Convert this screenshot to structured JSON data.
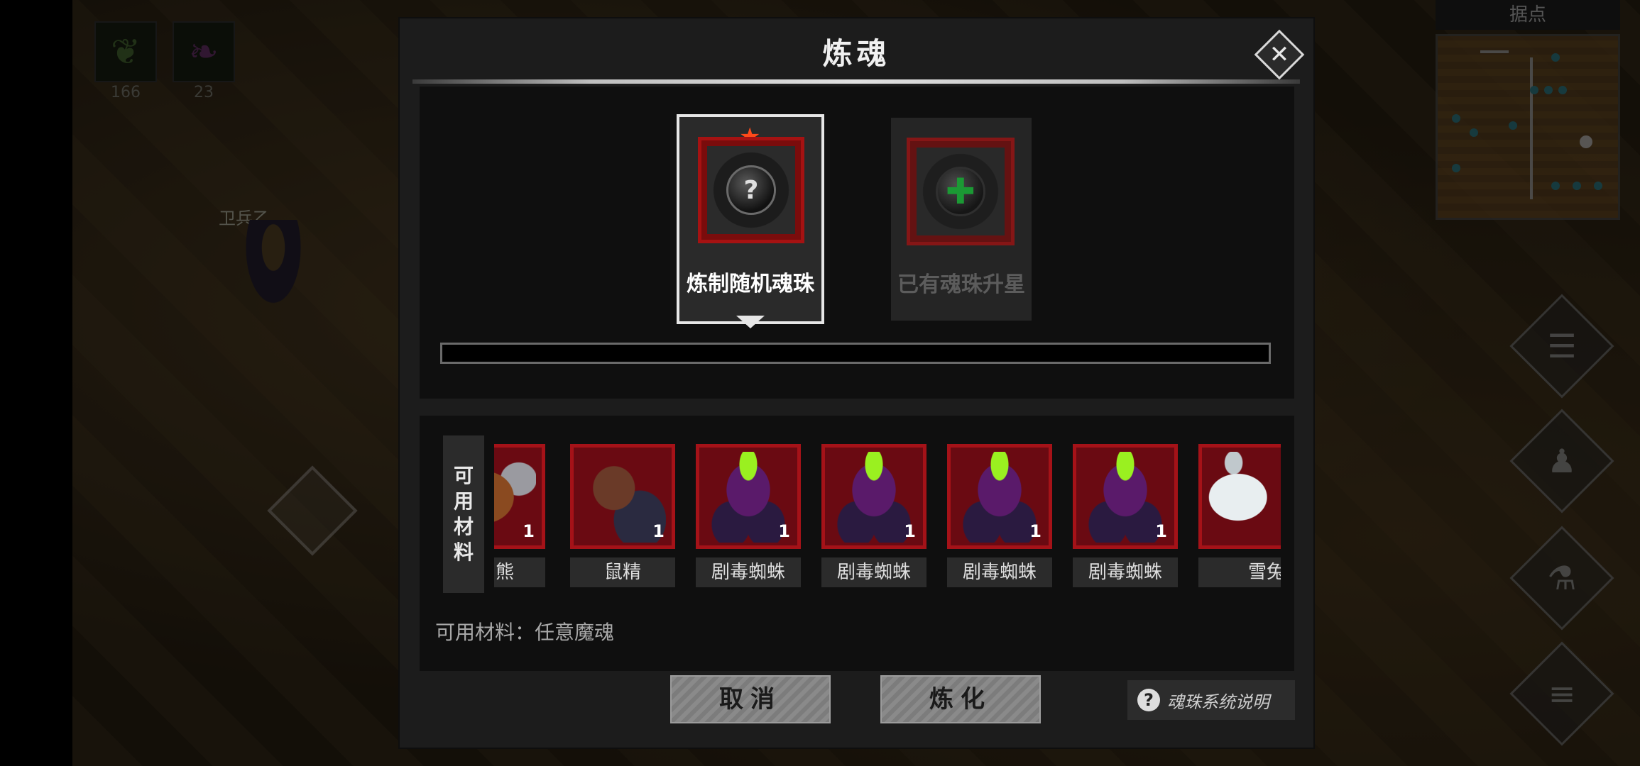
{
  "hud": {
    "slots": [
      {
        "icon": "green-leaf-icon",
        "count": "166"
      },
      {
        "icon": "purple-feather-icon",
        "count": "23"
      }
    ],
    "npc_name": "卫兵乙",
    "minimap_title": "据点"
  },
  "side_buttons": [
    {
      "icon": "scroll-icon"
    },
    {
      "icon": "party-icon"
    },
    {
      "icon": "potion-icon"
    },
    {
      "icon": "menu-icon"
    }
  ],
  "dialog": {
    "title": "炼魂",
    "close_glyph": "✕",
    "options": [
      {
        "label": "炼制随机魂珠",
        "icon": "question-orb-icon",
        "glyph": "?",
        "selected": true
      },
      {
        "label": "已有魂珠升星",
        "icon": "plus-orb-icon",
        "glyph": "✚",
        "selected": false
      }
    ],
    "progress": 0,
    "materials_side_label": [
      "可",
      "用",
      "材",
      "料"
    ],
    "materials": [
      {
        "name": "熊",
        "count": "1",
        "art": "bear"
      },
      {
        "name": "鼠精",
        "count": "1",
        "art": "rat"
      },
      {
        "name": "剧毒蜘蛛",
        "count": "1",
        "art": "spider"
      },
      {
        "name": "剧毒蜘蛛",
        "count": "1",
        "art": "spider"
      },
      {
        "name": "剧毒蜘蛛",
        "count": "1",
        "art": "spider"
      },
      {
        "name": "剧毒蜘蛛",
        "count": "1",
        "art": "spider"
      },
      {
        "name": "雪兔",
        "count": "",
        "art": "rabbit"
      }
    ],
    "materials_note": "可用材料：任意魔魂",
    "cancel_label": "取消",
    "refine_label": "炼化",
    "help_label": "魂珠系统说明",
    "help_glyph": "?"
  },
  "colors": {
    "accent_red": "#a51212",
    "star": "#ff4a1a",
    "plus_green": "#18c03a"
  }
}
